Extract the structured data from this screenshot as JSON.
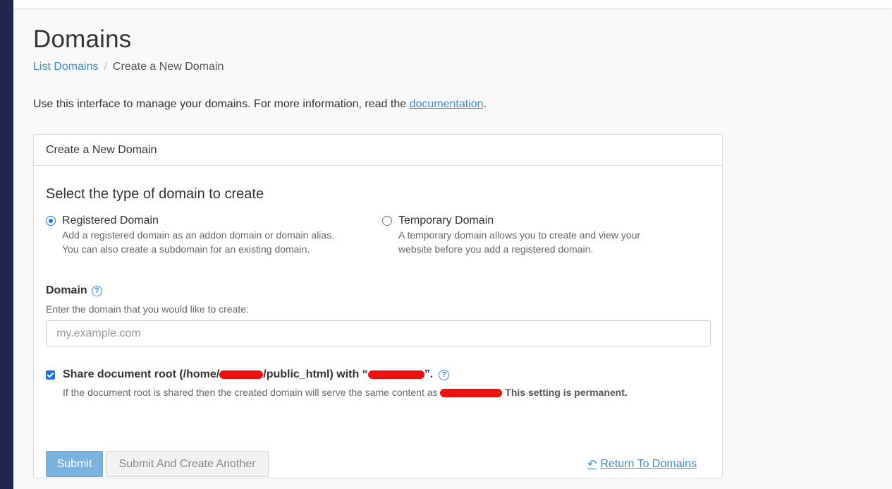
{
  "page": {
    "title": "Domains",
    "breadcrumb": {
      "parent": "List Domains",
      "separator": "/",
      "current": "Create a New Domain"
    },
    "intro_text": "Use this interface to manage your domains. For more information, read the ",
    "intro_link": "documentation",
    "intro_end": "."
  },
  "panel": {
    "heading": "Create a New Domain",
    "section_title": "Select the type of domain to create",
    "options": [
      {
        "label": "Registered Domain",
        "desc1": "Add a registered domain as an addon domain or domain alias.",
        "desc2": "You can also create a subdomain for an existing domain.",
        "checked": true
      },
      {
        "label": "Temporary Domain",
        "desc1": "A temporary domain allows you to create and view your",
        "desc2": "website before you add a registered domain.",
        "checked": false
      }
    ],
    "domain_label": "Domain",
    "domain_hint": "Enter the domain that you would like to create:",
    "domain_placeholder": "my.example.com",
    "share": {
      "label_start": "Share document root (/home/",
      "label_mid": "/public_html) with “",
      "label_end": "”.",
      "note_start": "If the document root is shared then the created domain will serve the same content as",
      "note_bold": "This setting is permanent.",
      "checked": true
    },
    "buttons": {
      "submit": "Submit",
      "submit_another": "Submit And Create Another",
      "return": "Return To Domains"
    }
  },
  "colors": {
    "sidebar": "#21264f",
    "link": "#3d8bc9",
    "accent": "#1a73e8",
    "redaction": "#ee1111"
  }
}
